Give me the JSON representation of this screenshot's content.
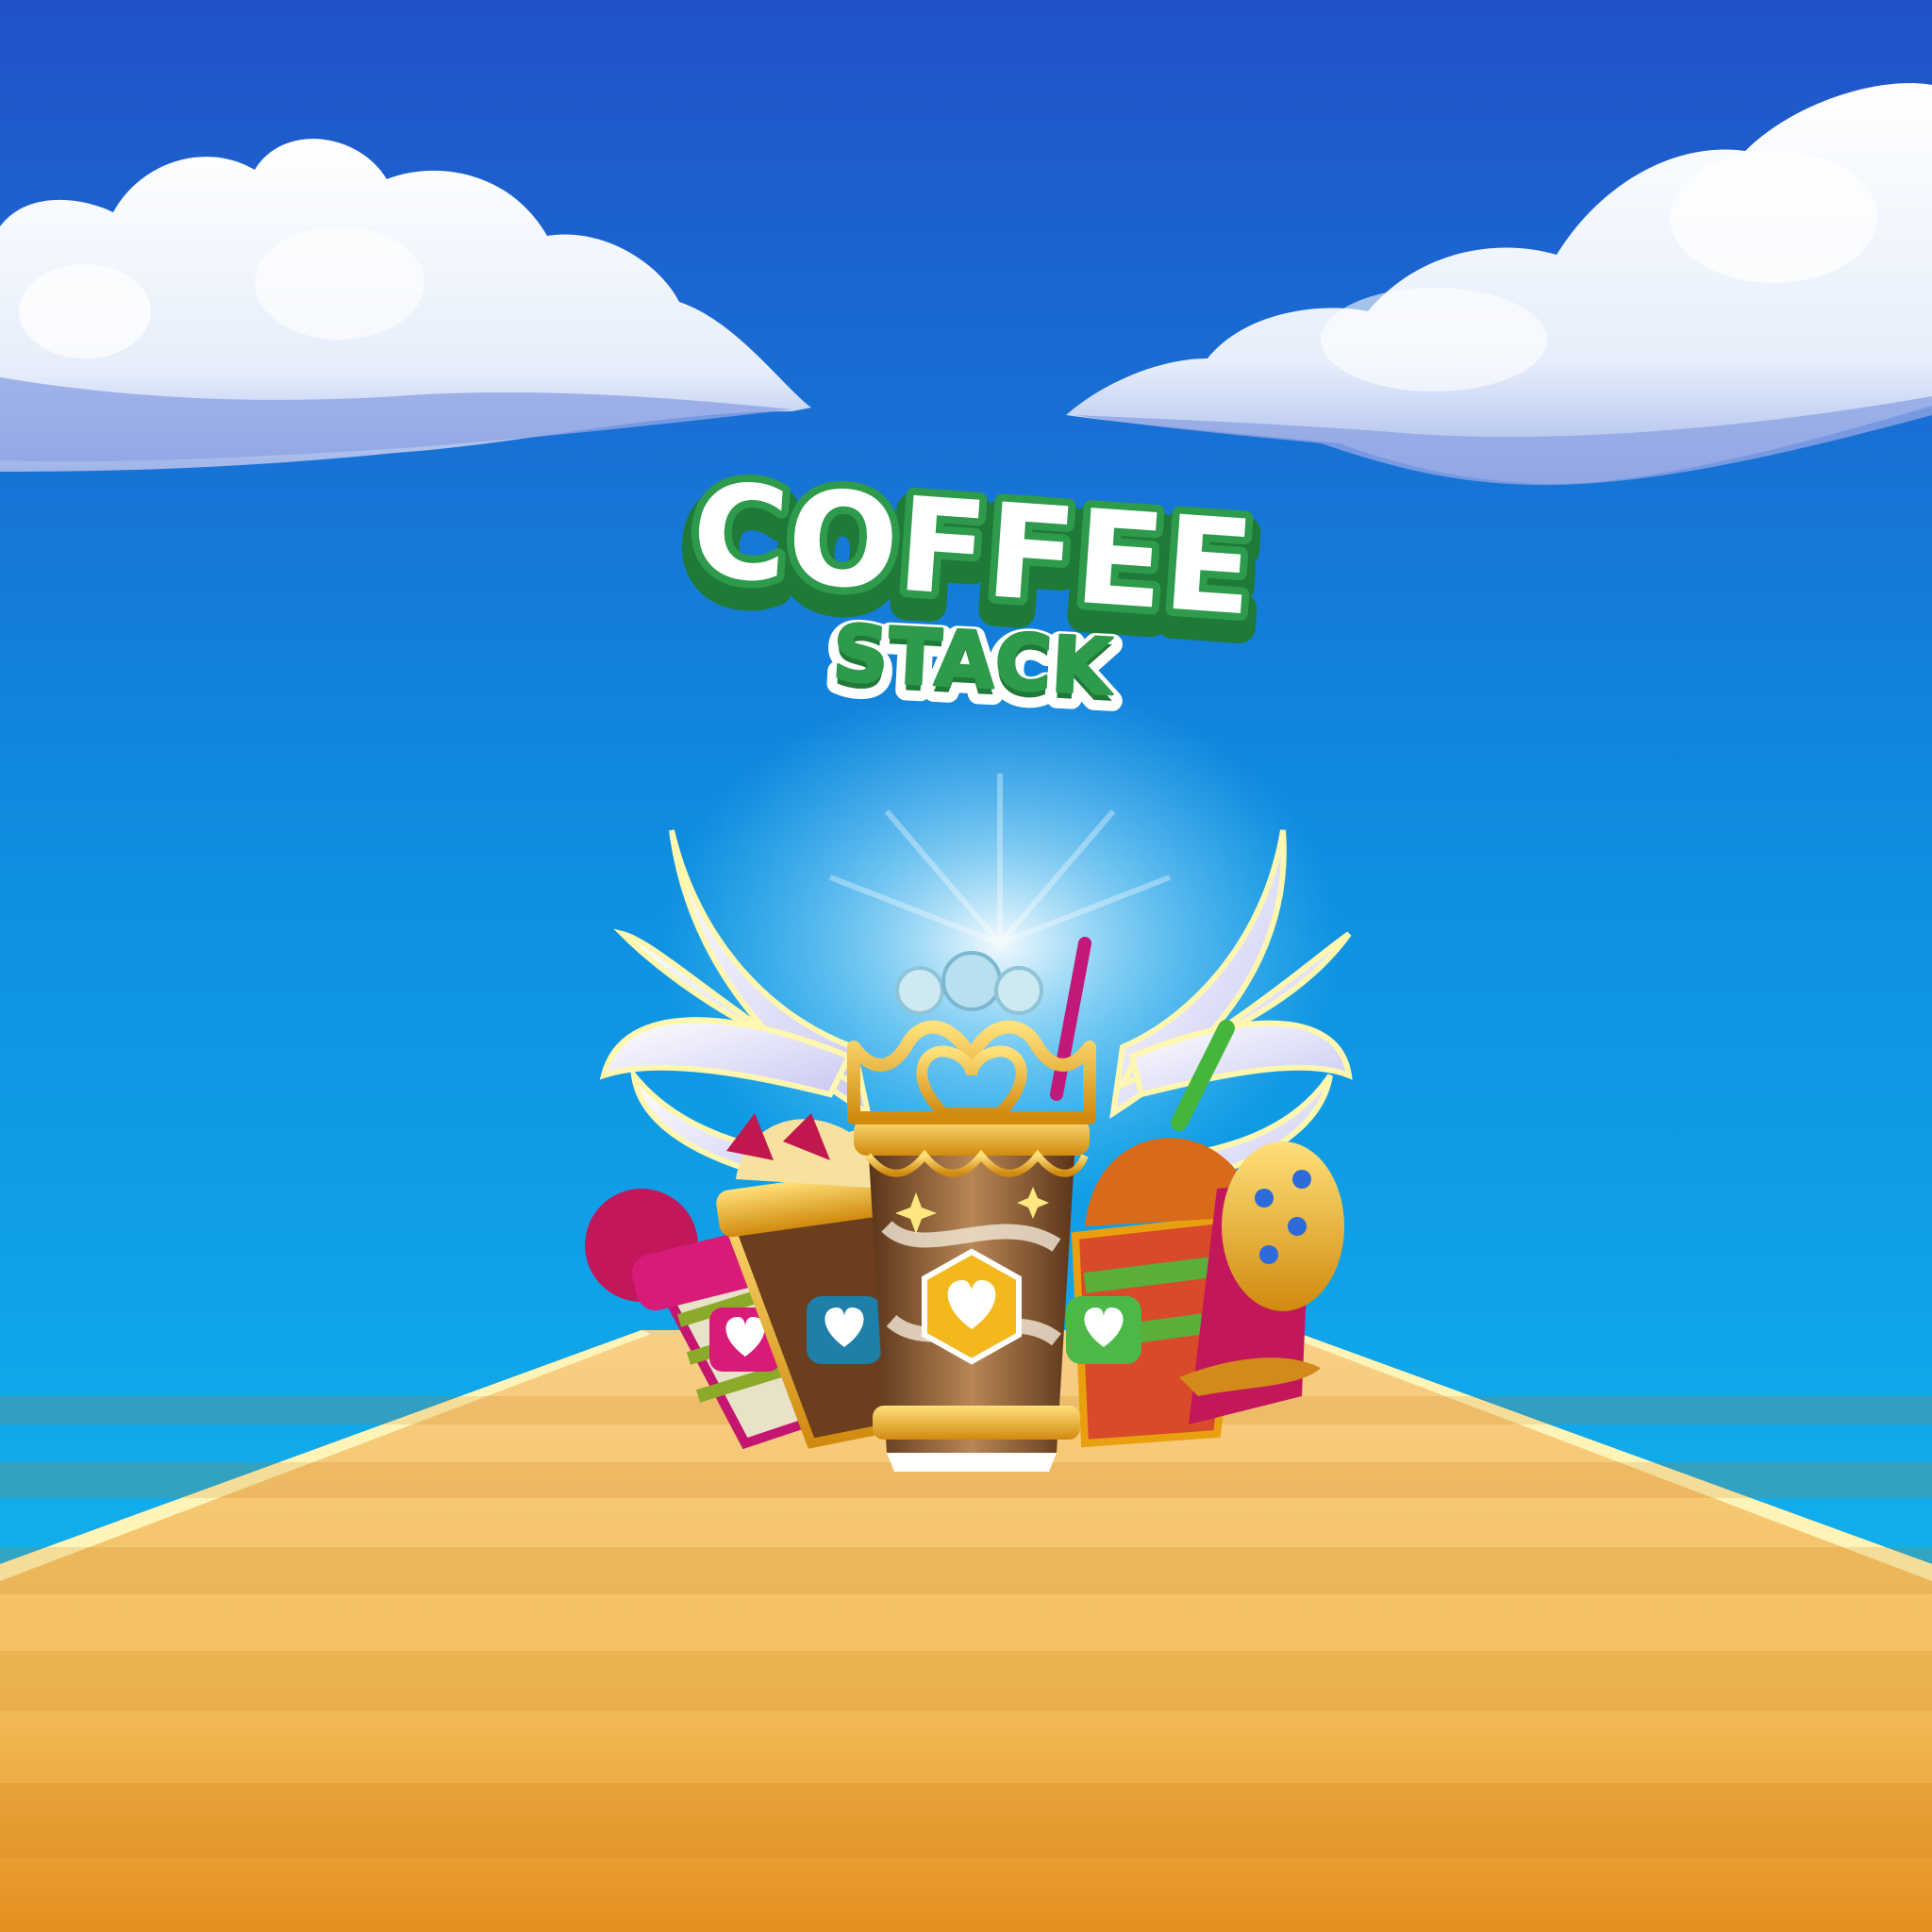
{
  "logo": {
    "line1": "COFFEE",
    "line2": "STACK"
  },
  "colors": {
    "sky_top": "#2152C8",
    "sky_mid": "#0E8FE0",
    "sky_bottom": "#13BFF2",
    "logo_green": "#2E9A4C",
    "logo_green_dark": "#1F7A38",
    "logo_white": "#FFFFFF",
    "road_light": "#F7C66C",
    "road_dark": "#E89B27",
    "road_edge": "#FFF4B8",
    "cup_center": "#8A5A2B",
    "cup_pink": "#D81B78",
    "cup_green": "#4CB848",
    "gold": "#F2B81C"
  },
  "icons": {
    "center_cup_emblem": "heart-icon",
    "left_cup_emblem": "heart-icon",
    "right_cup_emblem": "heart-icon"
  }
}
